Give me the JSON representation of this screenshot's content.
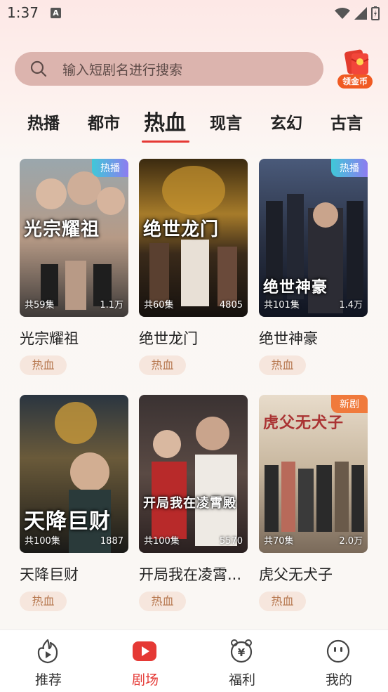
{
  "status_bar": {
    "time": "1:37",
    "notif_icon": "A"
  },
  "search": {
    "placeholder": "输入短剧名进行搜索",
    "coin_label": "领金币"
  },
  "tabs": [
    "热播",
    "都市",
    "热血",
    "现言",
    "玄幻",
    "古言"
  ],
  "active_tab": "热血",
  "cards": [
    {
      "title": "光宗耀祖",
      "poster_title": "光宗耀祖",
      "episodes": "共59集",
      "views": "1.1万",
      "badge": "热播",
      "tag": "热血"
    },
    {
      "title": "绝世龙门",
      "poster_title": "绝世龙门",
      "episodes": "共60集",
      "views": "4805",
      "badge": "",
      "tag": "热血"
    },
    {
      "title": "绝世神豪",
      "poster_title": "绝世神豪",
      "episodes": "共101集",
      "views": "1.4万",
      "badge": "热播",
      "tag": "热血"
    },
    {
      "title": "天降巨财",
      "poster_title": "天降巨财",
      "episodes": "共100集",
      "views": "1887",
      "badge": "",
      "tag": "热血"
    },
    {
      "title": "开局我在凌霄...",
      "poster_title": "开局我在凌霄殿",
      "episodes": "共100集",
      "views": "5570",
      "badge": "",
      "tag": "热血"
    },
    {
      "title": "虎父无犬子",
      "poster_title": "虎父无犬子",
      "episodes": "共70集",
      "views": "2.0万",
      "badge": "新剧",
      "tag": "热血"
    }
  ],
  "bottom_nav": [
    {
      "label": "推荐",
      "icon": "flame-play-icon"
    },
    {
      "label": "剧场",
      "icon": "play-icon"
    },
    {
      "label": "福利",
      "icon": "yen-pig-icon"
    },
    {
      "label": "我的",
      "icon": "smiley-icon"
    }
  ],
  "colors": {
    "accent": "#e53935",
    "badge_hot": "#4fc3d9",
    "badge_new": "#f07a3c",
    "tag_bg": "#f6e6dd"
  }
}
